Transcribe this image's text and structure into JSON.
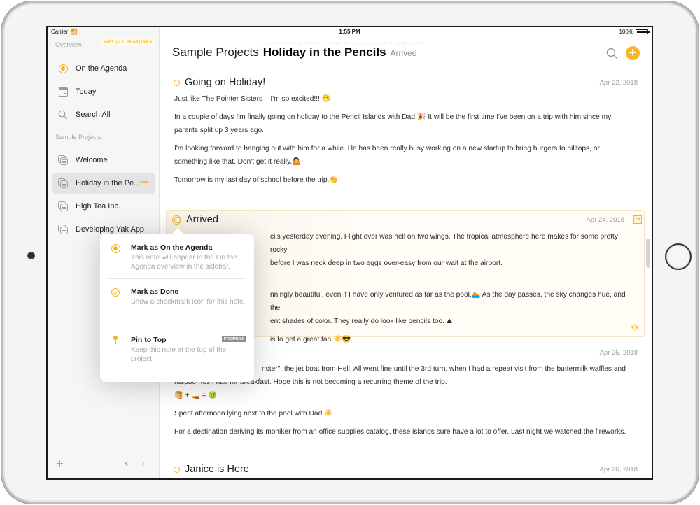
{
  "status_bar": {
    "carrier": "Carrier",
    "time": "1:55 PM",
    "battery": "100%"
  },
  "sidebar": {
    "promo_button": "GET ALL FEATURES",
    "overview_label": "Overview",
    "overview_items": [
      {
        "label": "On the Agenda",
        "icon": "agenda-dot-icon"
      },
      {
        "label": "Today",
        "icon": "calendar-icon"
      },
      {
        "label": "Search All",
        "icon": "search-icon"
      }
    ],
    "projects_label": "Sample Projects",
    "projects": [
      {
        "label": "Welcome",
        "icon": "document-stack-icon",
        "selected": false
      },
      {
        "label": "Holiday in the Pe...",
        "icon": "document-stack-icon",
        "selected": true,
        "more": "•••"
      },
      {
        "label": "High Tea Inc.",
        "icon": "document-stack-icon",
        "selected": false
      },
      {
        "label": "Developing Yak App",
        "icon": "document-stack-icon",
        "selected": false
      }
    ],
    "footer": {
      "add": "+",
      "back": "‹",
      "forward": "›"
    }
  },
  "header": {
    "ghost_hint": "You can change the sort order by clicking on the project title.",
    "project": "Sample Projects",
    "title": "Holiday in the Pencils",
    "status": "Arrived",
    "search_icon": "search-icon",
    "add_icon": "plus-circle-icon"
  },
  "notes": [
    {
      "title": "Going on Holiday!",
      "date": "Apr 22, 2018",
      "paragraphs": [
        "Just like The Pointer Sisters – I'm so excited!!! 😬",
        "In a couple of days I'm finally going on holiday to the Pencil Islands with Dad.🎉 It will be the first time I've been on a trip with him since my parents split up 3 years ago.",
        "I'm looking forward to hanging out with him for a while. He has been really busy working on a new startup to bring burgers to hilltops, or something like that. Don't get it really.🤷",
        "Tomorrow is my last day of school before the trip.👏"
      ]
    },
    {
      "title": "Arrived",
      "date": "Apr 24, 2018",
      "calendar_badge": "24",
      "paragraphs": [
        "cils yesterday evening. Flight over was hell on two wings. The tropical atmosphere here makes for some pretty rocky",
        "before I was neck deep in two eggs over-easy from our wait at the airport.",
        "nningly beautiful, even if I have only ventured as far as the pool.🏊 As the day passes, the sky changes hue, and the",
        "ent shades of color. They really do look like pencils too. ⛰",
        "is to get a great tan.☀️😎"
      ],
      "settings_icon": "gear-icon"
    },
    {
      "title": "",
      "date": "Apr 25, 2018",
      "paragraphs": [
        "nster\", the jet boat from Hell. All went fine until the 3rd turn, when I had a repeat visit from the buttermilk waffles and raspberries I had for breakfast. Hope this is not becoming a recurring theme of the trip.",
        "🥞 + 🚤 = 🤢",
        "Spent afternoon lying next to the pool with Dad.☀️",
        "For a destination deriving its moniker from an office supplies catalog, these islands sure have a lot to offer. Last night we watched the fireworks."
      ]
    },
    {
      "title": "Janice is Here",
      "date": "Apr 26, 2018",
      "paragraphs": []
    }
  ],
  "popover": {
    "items": [
      {
        "title": "Mark as On the Agenda",
        "description": "This note will appear in the On the Agenda overview in the sidebar.",
        "icon": "agenda-dot-icon"
      },
      {
        "title": "Mark as Done",
        "description": "Show a checkmark icon for this note.",
        "icon": "checkmark-circle-icon"
      },
      {
        "title": "Pin to Top",
        "description": "Keep this note at the top of the project.",
        "icon": "pin-icon",
        "badge": "PREMIUM"
      }
    ]
  },
  "colors": {
    "accent": "#f5b324",
    "selected_row": "#e4e4e6",
    "sidebar_bg": "#f6f6f7",
    "highlight_note_bg": "#fffdf5"
  }
}
